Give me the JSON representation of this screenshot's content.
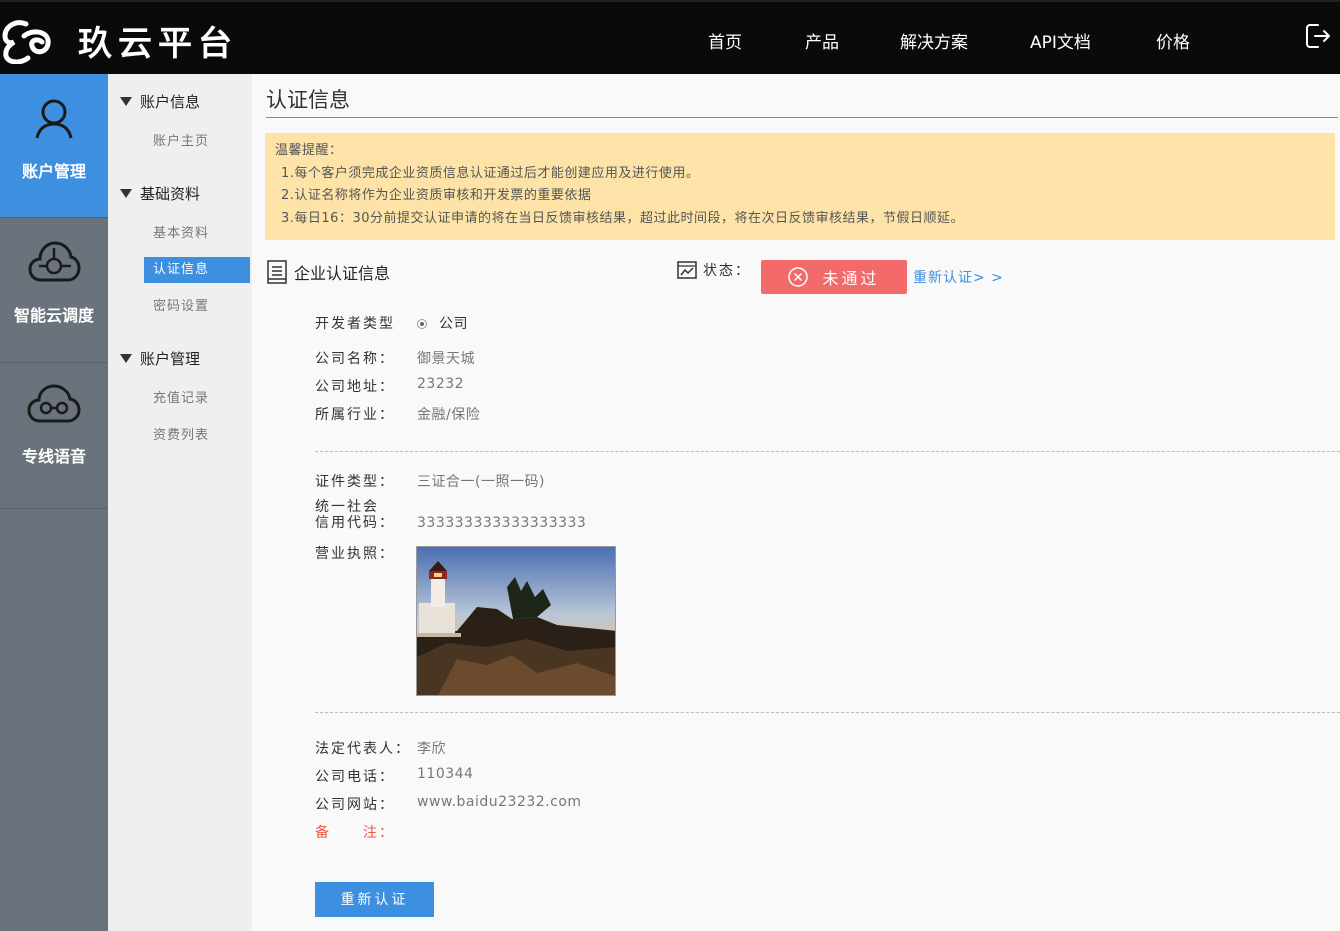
{
  "header": {
    "logo_text": "玖云平台",
    "nav": [
      {
        "label": "首页"
      },
      {
        "label": "产品"
      },
      {
        "label": "解决方案"
      },
      {
        "label": "API文档"
      },
      {
        "label": "价格"
      }
    ]
  },
  "rail": {
    "items": [
      {
        "label": "账户管理",
        "icon": "user-icon"
      },
      {
        "label": "智能云调度",
        "icon": "cloud-network-icon"
      },
      {
        "label": "专线语音",
        "icon": "cloud-voice-icon"
      }
    ]
  },
  "subnav": {
    "groups": [
      {
        "title": "账户信息",
        "items": [
          "账户主页"
        ]
      },
      {
        "title": "基础资料",
        "items": [
          "基本资料",
          "认证信息",
          "密码设置"
        ]
      },
      {
        "title": "账户管理",
        "items": [
          "充值记录",
          "资费列表"
        ]
      }
    ]
  },
  "page": {
    "title": "认证信息",
    "notice": {
      "head": "温馨提醒：",
      "lines": [
        "1.每个客户须完成企业资质信息认证通过后才能创建应用及进行使用。",
        "2.认证名称将作为企业资质审核和开发票的重要依据",
        "3.每日16：30分前提交认证申请的将在当日反馈审核结果，超过此时间段，将在次日反馈审核结果，节假日顺延。"
      ]
    },
    "section_title": "企业认证信息",
    "status_label": "状态：",
    "status_value": "未通过",
    "recert_link": "重新认证> >",
    "fields": {
      "dev_type": {
        "label": "开发者类型",
        "value": "公司"
      },
      "company_name": {
        "label": "公司名称：",
        "value": "御景天城"
      },
      "company_addr": {
        "label": "公司地址：",
        "value": "23232"
      },
      "industry": {
        "label": "所属行业：",
        "value": "金融/保险"
      },
      "cert_type": {
        "label": "证件类型：",
        "value": "三证合一(一照一码)"
      },
      "credit_code": {
        "label_line1": "统一社会",
        "label_line2": "信用代码：",
        "value": "333333333333333333"
      },
      "license": {
        "label": "营业执照："
      },
      "legal_rep": {
        "label": "法定代表人：",
        "value": "李欣"
      },
      "phone": {
        "label": "公司电话：",
        "value": "110344"
      },
      "website": {
        "label": "公司网站：",
        "value": "www.baidu23232.com"
      },
      "remark": {
        "label": "备　　注：",
        "value": ""
      }
    },
    "submit_button": "重新认证"
  },
  "colors": {
    "accent": "#3d8fe0",
    "rail_bg": "#6a737c",
    "notice_bg": "#fde3a7",
    "status_fail": "#f26a6a"
  }
}
